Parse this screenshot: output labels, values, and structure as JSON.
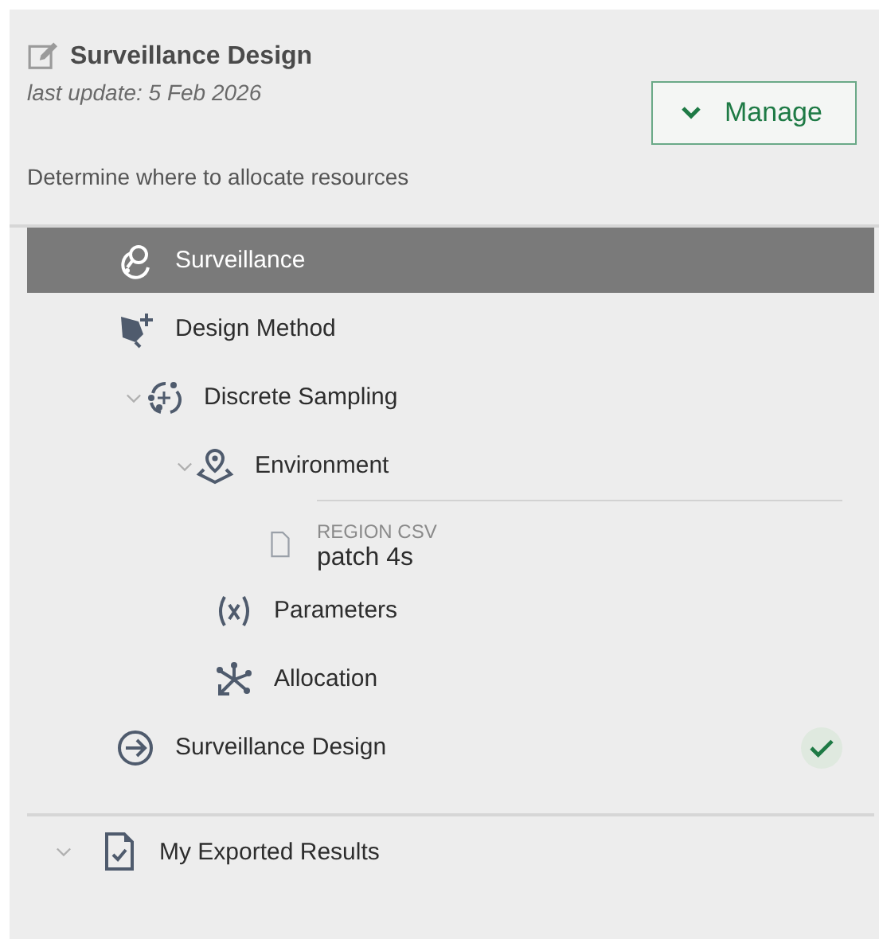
{
  "header": {
    "title": "Surveillance Design",
    "updated": "last update: 5 Feb 2026",
    "description": "Determine where to allocate resources",
    "manage_button": "Manage"
  },
  "tree": [
    {
      "label": "Surveillance",
      "kind": "surveillance",
      "selected": true
    },
    {
      "label": "Design Method",
      "kind": "method",
      "selected": false
    },
    {
      "label": "Discrete Sampling",
      "kind": "sampling",
      "selected": false,
      "expanded": true,
      "children": [
        {
          "label": "Environment",
          "kind": "environment",
          "selected": false,
          "expanded": true,
          "children": [
            {
              "kind": "file",
              "caption": "REGION CSV",
              "label": "patch 4s",
              "selected": false
            }
          ]
        },
        {
          "label": "Parameters",
          "kind": "parameters",
          "selected": false
        },
        {
          "label": "Allocation",
          "kind": "allocation",
          "selected": false
        }
      ]
    },
    {
      "label": "Surveillance Design",
      "kind": "result",
      "selected": false,
      "done": true
    }
  ],
  "exports": {
    "label": "My Exported Results",
    "expanded": true
  }
}
